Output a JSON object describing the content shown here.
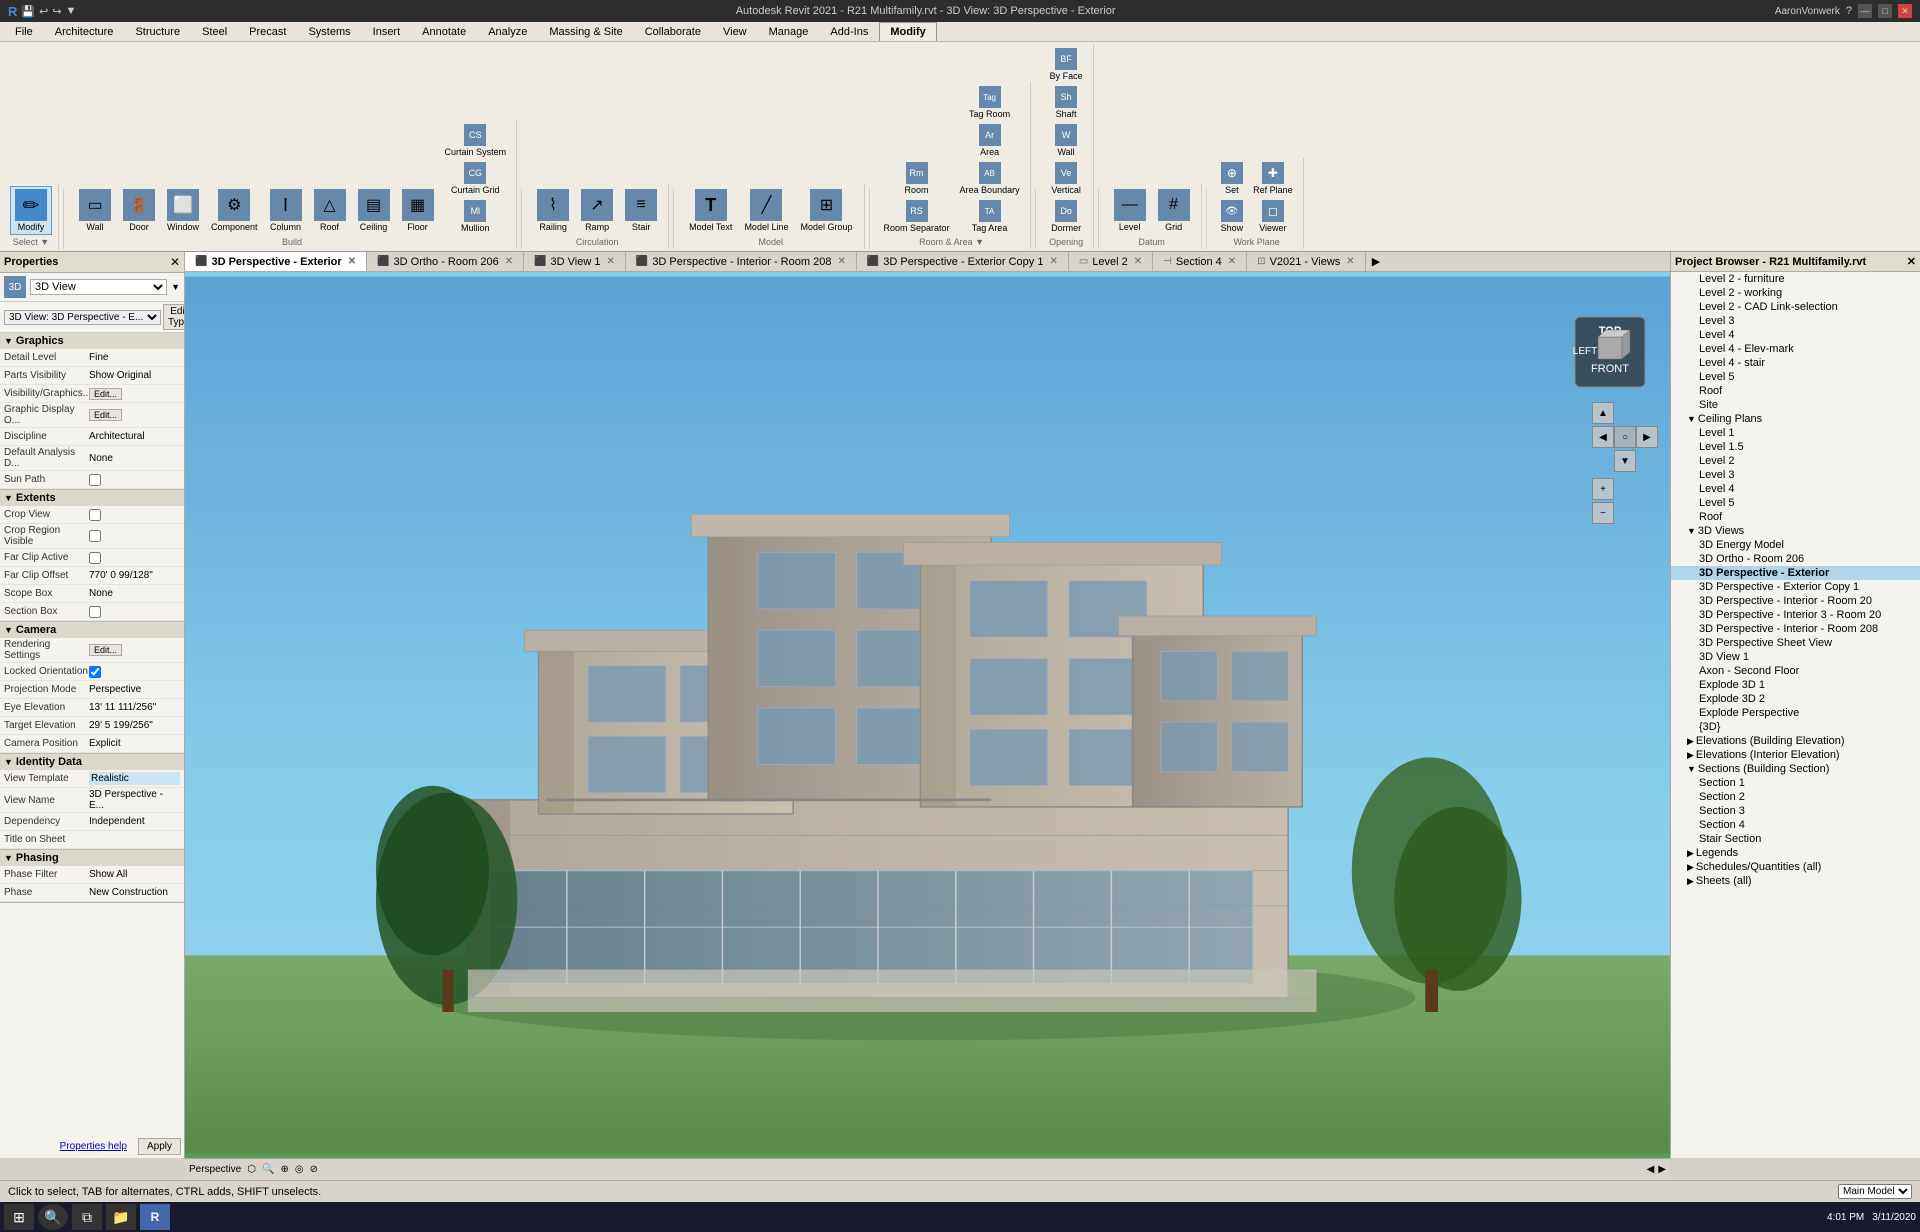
{
  "titlebar": {
    "title": "Autodesk Revit 2021 - R21 Multifamily.rvt - 3D View: 3D Perspective - Exterior",
    "user": "AaronVonwerk"
  },
  "ribbon": {
    "tabs": [
      "File",
      "Architecture",
      "Structure",
      "Steel",
      "Precast",
      "Systems",
      "Insert",
      "Annotate",
      "Analyze",
      "Massing & Site",
      "Collaborate",
      "View",
      "Manage",
      "Add-Ins",
      "Modify"
    ],
    "active_tab": "Modify",
    "groups": {
      "select": {
        "label": "Select",
        "btn": "Modify"
      },
      "build": {
        "label": "Build",
        "buttons": [
          "Wall",
          "Door",
          "Window",
          "Component",
          "Column",
          "Roof",
          "Ceiling",
          "Floor",
          "Curtain System",
          "Curtain Grid",
          "Mullion"
        ]
      },
      "circulation": {
        "label": "Circulation",
        "buttons": [
          "Railing",
          "Ramp",
          "Stair"
        ]
      },
      "model": {
        "label": "Model",
        "buttons": [
          "Model Text",
          "Model Line",
          "Model Group"
        ]
      },
      "room_area": {
        "label": "Room & Area",
        "buttons": [
          "Room",
          "Room Separator",
          "Tag Room",
          "Area",
          "Area Boundary",
          "Tag Area"
        ]
      },
      "opening": {
        "label": "Opening",
        "buttons": [
          "By Face",
          "Shaft",
          "Wall",
          "Vertical",
          "Dormer"
        ]
      },
      "datum": {
        "label": "Datum",
        "buttons": [
          "Level",
          "Grid"
        ]
      },
      "work_plane": {
        "label": "Work Plane",
        "buttons": [
          "Set",
          "Show",
          "Ref Plane",
          "Viewer"
        ]
      }
    }
  },
  "view_tabs": [
    {
      "id": "3d-perspective-exterior",
      "label": "3D Perspective - Exterior",
      "active": true,
      "icon": "3d"
    },
    {
      "id": "3d-ortho-206",
      "label": "3D Ortho - Room 206",
      "active": false,
      "icon": "3d"
    },
    {
      "id": "3d-view-1",
      "label": "3D View 1",
      "active": false,
      "icon": "3d"
    },
    {
      "id": "3d-perspective-interior-208",
      "label": "3D Perspective - Interior - Room 208",
      "active": false,
      "icon": "3d"
    },
    {
      "id": "3d-perspective-exterior-copy",
      "label": "3D Perspective - Exterior Copy 1",
      "active": false,
      "icon": "3d"
    },
    {
      "id": "level-2",
      "label": "Level 2",
      "active": false,
      "icon": "plan"
    },
    {
      "id": "section-4",
      "label": "Section 4",
      "active": false,
      "icon": "section"
    },
    {
      "id": "v2021-views",
      "label": "V2021 - Views",
      "active": false,
      "icon": "sheet"
    }
  ],
  "properties": {
    "header": "Properties",
    "view_type": "3D View",
    "view_name_display": "3D View: 3D Perspective - E...",
    "edit_type_label": "Edit Type",
    "sections": {
      "graphics": {
        "label": "Graphics",
        "rows": [
          {
            "label": "Detail Level",
            "value": "Fine"
          },
          {
            "label": "Parts Visibility",
            "value": "Show Original"
          },
          {
            "label": "Visibility/Graphics...",
            "value": "Edit...",
            "type": "btn"
          },
          {
            "label": "Graphic Display O...",
            "value": "Edit...",
            "type": "btn"
          },
          {
            "label": "Discipline",
            "value": "Architectural"
          },
          {
            "label": "Default Analysis D...",
            "value": "None"
          },
          {
            "label": "Sun Path",
            "value": "",
            "type": "checkbox"
          }
        ]
      },
      "extents": {
        "label": "Extents",
        "rows": [
          {
            "label": "Crop View",
            "value": "",
            "type": "checkbox"
          },
          {
            "label": "Crop Region Visible",
            "value": "",
            "type": "checkbox"
          },
          {
            "label": "Far Clip Active",
            "value": "",
            "type": "checkbox"
          },
          {
            "label": "Far Clip Offset",
            "value": "770' 0 99/128\""
          },
          {
            "label": "Scope Box",
            "value": "None"
          },
          {
            "label": "Section Box",
            "value": "",
            "type": "checkbox"
          }
        ]
      },
      "camera": {
        "label": "Camera",
        "rows": [
          {
            "label": "Rendering Settings",
            "value": "Edit...",
            "type": "btn"
          },
          {
            "label": "Locked Orientation",
            "value": "",
            "type": "checkbox_checked"
          },
          {
            "label": "Projection Mode",
            "value": "Perspective"
          },
          {
            "label": "Eye Elevation",
            "value": "13' 11 111/256\""
          },
          {
            "label": "Target Elevation",
            "value": "29' 5 199/256\""
          },
          {
            "label": "Camera Position",
            "value": "Explicit"
          }
        ]
      },
      "identity": {
        "label": "Identity Data",
        "rows": [
          {
            "label": "View Template",
            "value": "Realistic",
            "type": "highlight"
          },
          {
            "label": "View Name",
            "value": "3D Perspective - E..."
          },
          {
            "label": "Dependency",
            "value": "Independent"
          },
          {
            "label": "Title on Sheet",
            "value": ""
          }
        ]
      },
      "phasing": {
        "label": "Phasing",
        "rows": [
          {
            "label": "Phase Filter",
            "value": "Show All"
          },
          {
            "label": "Phase",
            "value": "New Construction"
          }
        ]
      }
    },
    "apply_label": "Apply",
    "properties_help": "Properties help"
  },
  "project_browser": {
    "title": "Project Browser - R21 Multifamily.rvt",
    "tree": [
      {
        "label": "Level 2 - furniture",
        "indent": 2
      },
      {
        "label": "Level 2 - working",
        "indent": 2
      },
      {
        "label": "Level 2 - CAD Link-selection",
        "indent": 2
      },
      {
        "label": "Level 3",
        "indent": 2
      },
      {
        "label": "Level 4",
        "indent": 2
      },
      {
        "label": "Level 4 - Elev-mark",
        "indent": 2
      },
      {
        "label": "Level 4 - stair",
        "indent": 2
      },
      {
        "label": "Level 5",
        "indent": 2
      },
      {
        "label": "Roof",
        "indent": 2
      },
      {
        "label": "Site",
        "indent": 2
      },
      {
        "label": "Ceiling Plans",
        "indent": 1,
        "expandable": true,
        "expanded": true
      },
      {
        "label": "Level 1",
        "indent": 2
      },
      {
        "label": "Level 1.5",
        "indent": 2
      },
      {
        "label": "Level 2",
        "indent": 2
      },
      {
        "label": "Level 3",
        "indent": 2
      },
      {
        "label": "Level 4",
        "indent": 2
      },
      {
        "label": "Level 5",
        "indent": 2
      },
      {
        "label": "Roof",
        "indent": 2
      },
      {
        "label": "3D Views",
        "indent": 1,
        "expandable": true,
        "expanded": true
      },
      {
        "label": "3D Energy Model",
        "indent": 2
      },
      {
        "label": "3D Ortho - Room 206",
        "indent": 2
      },
      {
        "label": "3D Perspective - Exterior",
        "indent": 2,
        "selected": true
      },
      {
        "label": "3D Perspective - Exterior Copy 1",
        "indent": 2
      },
      {
        "label": "3D Perspective - Interior - Room 20",
        "indent": 2
      },
      {
        "label": "3D Perspective - Interior 3 - Room 20",
        "indent": 2
      },
      {
        "label": "3D Perspective - Interior - Room 208",
        "indent": 2
      },
      {
        "label": "3D Perspective Sheet View",
        "indent": 2
      },
      {
        "label": "3D View 1",
        "indent": 2
      },
      {
        "label": "Axon - Second Floor",
        "indent": 2
      },
      {
        "label": "Explode 3D 1",
        "indent": 2
      },
      {
        "label": "Explode 3D 2",
        "indent": 2
      },
      {
        "label": "Explode Perspective",
        "indent": 2
      },
      {
        "label": "{3D}",
        "indent": 2
      },
      {
        "label": "Elevations (Building Elevation)",
        "indent": 1,
        "expandable": true
      },
      {
        "label": "Elevations (Interior Elevation)",
        "indent": 1,
        "expandable": true
      },
      {
        "label": "Sections (Building Section)",
        "indent": 1,
        "expandable": true,
        "expanded": true
      },
      {
        "label": "Section 1",
        "indent": 2
      },
      {
        "label": "Section 2",
        "indent": 2
      },
      {
        "label": "Section 3",
        "indent": 2
      },
      {
        "label": "Section 4",
        "indent": 2
      },
      {
        "label": "Stair Section",
        "indent": 2
      },
      {
        "label": "Legends",
        "indent": 1,
        "expandable": true
      },
      {
        "label": "Schedules/Quantities (all)",
        "indent": 1,
        "expandable": true
      },
      {
        "label": "Sheets (all)",
        "indent": 1,
        "expandable": true
      }
    ]
  },
  "status_bar": {
    "view_type": "Perspective",
    "help_text": "Click to select, TAB for alternates, CTRL adds, SHIFT unselects.",
    "model": "Main Model",
    "time": "4:01 PM",
    "date": "3/11/2020"
  },
  "icons": {
    "modify": "✏",
    "wall": "▭",
    "door": "🚪",
    "window": "⬜",
    "component": "⚙",
    "column": "I",
    "roof": "🏠",
    "ceiling": "▤",
    "floor": "▦",
    "railing": "⌇",
    "ramp": "↗",
    "stair": "≡",
    "model_text": "T",
    "model_line": "╱",
    "model_group": "⊞",
    "room": "⊡",
    "level": "—",
    "grid": "#",
    "set": "⊕",
    "show": "👁",
    "ref_plane": "✚",
    "viewer": "◻",
    "close": "✕",
    "arrow_right": "▶",
    "arrow_down": "▼",
    "folder": "📁",
    "checkbox_empty": "☐",
    "checkbox_checked": "☑"
  }
}
